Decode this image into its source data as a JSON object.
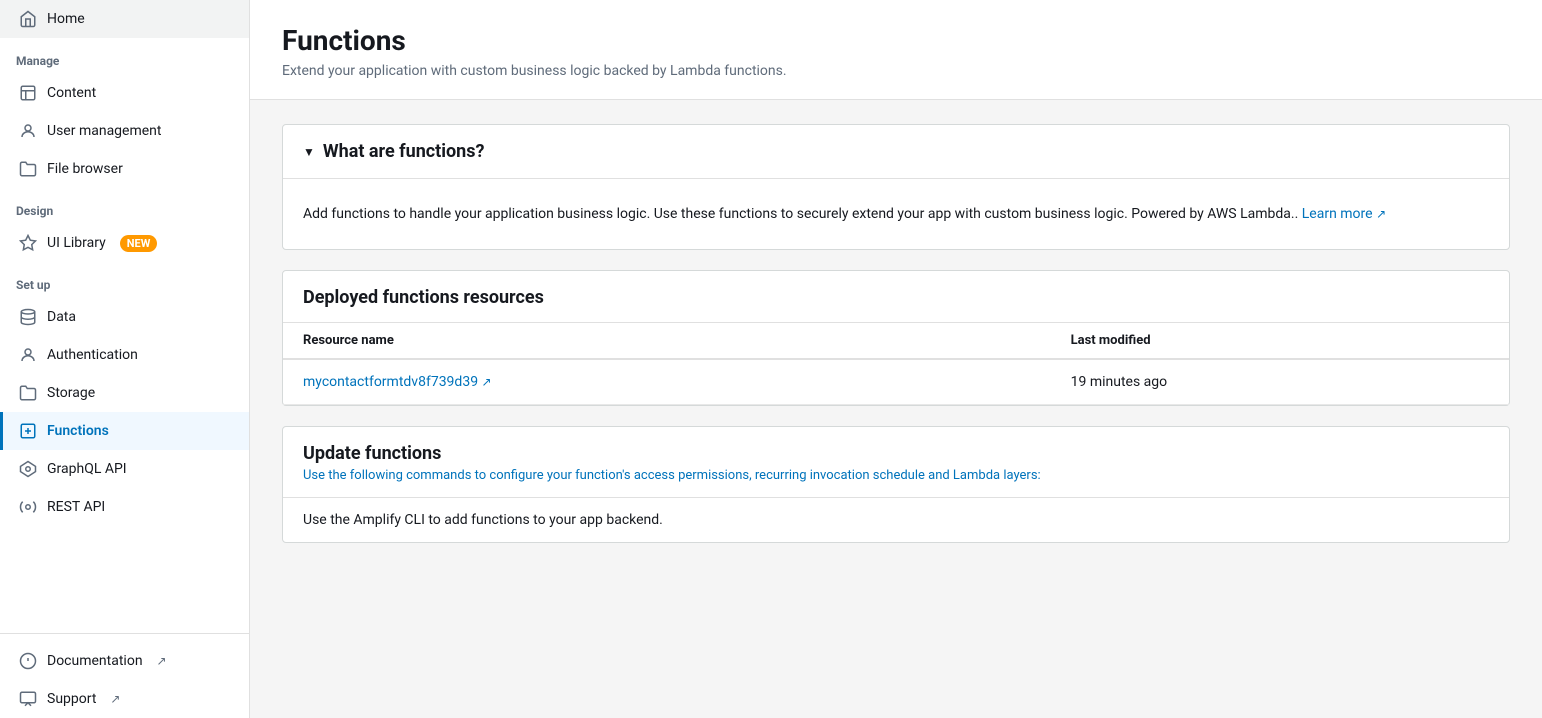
{
  "sidebar": {
    "sections": [
      {
        "label": "",
        "items": [
          {
            "id": "home",
            "label": "Home",
            "icon": "home",
            "active": false
          }
        ]
      },
      {
        "label": "Manage",
        "items": [
          {
            "id": "content",
            "label": "Content",
            "icon": "content",
            "active": false
          },
          {
            "id": "user-management",
            "label": "User management",
            "icon": "user",
            "active": false
          },
          {
            "id": "file-browser",
            "label": "File browser",
            "icon": "folder",
            "active": false
          }
        ]
      },
      {
        "label": "Design",
        "items": [
          {
            "id": "ui-library",
            "label": "UI Library",
            "icon": "diamond",
            "active": false,
            "badge": "NEW"
          }
        ]
      },
      {
        "label": "Set up",
        "items": [
          {
            "id": "data",
            "label": "Data",
            "icon": "data",
            "active": false
          },
          {
            "id": "authentication",
            "label": "Authentication",
            "icon": "auth",
            "active": false
          },
          {
            "id": "storage",
            "label": "Storage",
            "icon": "storage",
            "active": false
          },
          {
            "id": "functions",
            "label": "Functions",
            "icon": "functions",
            "active": true
          },
          {
            "id": "graphql-api",
            "label": "GraphQL API",
            "icon": "graphql",
            "active": false
          },
          {
            "id": "rest-api",
            "label": "REST API",
            "icon": "rest",
            "active": false
          }
        ]
      }
    ],
    "bottom_items": [
      {
        "id": "documentation",
        "label": "Documentation",
        "icon": "docs",
        "external": true
      },
      {
        "id": "support",
        "label": "Support",
        "icon": "support",
        "external": true
      }
    ]
  },
  "page": {
    "title": "Functions",
    "subtitle": "Extend your application with custom business logic backed by Lambda functions."
  },
  "what_are_functions": {
    "section_title": "What are functions?",
    "body_text": "Add functions to handle your application business logic. Use these functions to securely extend your app with custom business logic. Powered by AWS Lambda..",
    "learn_more_label": "Learn more",
    "learn_more_href": "#"
  },
  "deployed_resources": {
    "section_title": "Deployed functions resources",
    "columns": [
      "Resource name",
      "Last modified"
    ],
    "rows": [
      {
        "name": "mycontactformtdv8f739d39",
        "last_modified": "19 minutes ago",
        "href": "#"
      }
    ]
  },
  "update_functions": {
    "section_title": "Update functions",
    "subtitle": "Use the following commands to configure your function's access permissions, recurring invocation schedule and Lambda layers:",
    "body_text": "Use the Amplify CLI to add functions to your app backend."
  }
}
